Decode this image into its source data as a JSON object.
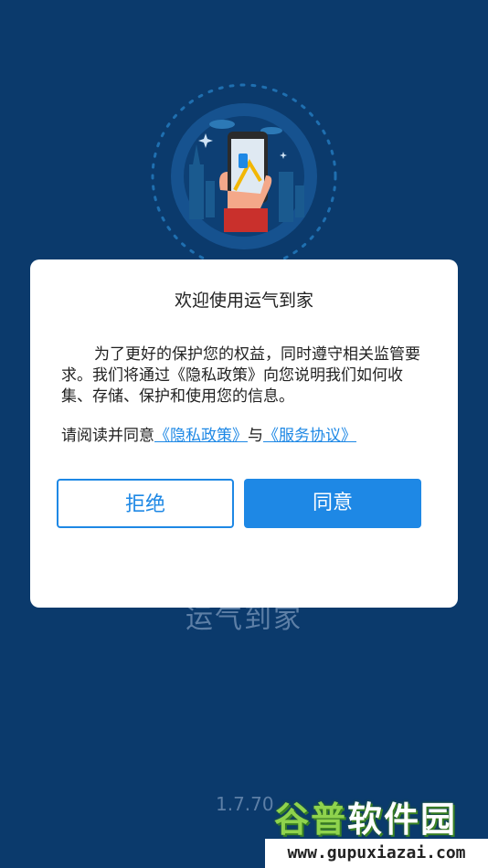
{
  "splash": {
    "app_name": "运气到家",
    "version": "1.7.70"
  },
  "dialog": {
    "title": "欢迎使用运气到家",
    "body": "为了更好的保护您的权益，同时遵守相关监管要求。我们将通过《隐私政策》向您说明我们如何收集、存储、保护和使用您的信息。",
    "consent_prefix": "请阅读并同意",
    "privacy_link": "《隐私政策》",
    "consent_joiner": "与",
    "service_link": "《服务协议》",
    "reject_label": "拒绝",
    "agree_label": "同意"
  },
  "watermark": {
    "logo_part1": "谷普",
    "logo_part2": "软件园",
    "url": "www.gupuxiazai.com"
  },
  "colors": {
    "background": "#0b3a6c",
    "accent": "#1e88e5",
    "dialog_bg": "#ffffff"
  },
  "icons": {
    "illustration": "hand-holding-phone-icon"
  }
}
